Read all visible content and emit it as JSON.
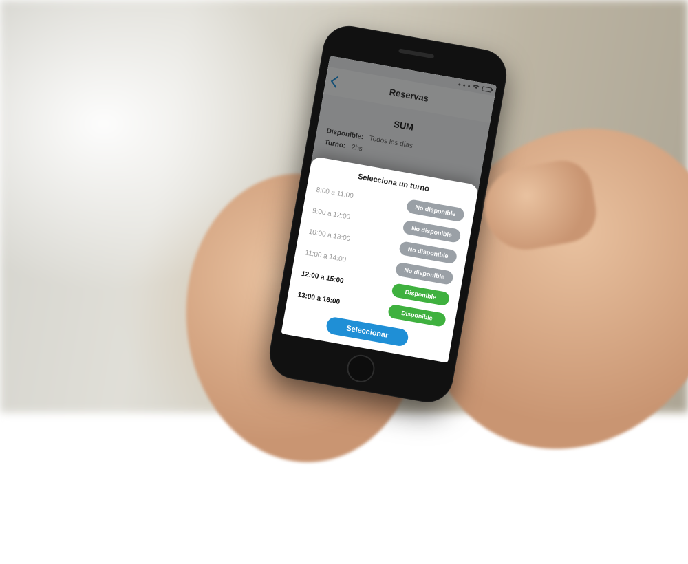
{
  "nav": {
    "title": "Reservas"
  },
  "section": {
    "title": "SUM"
  },
  "meta": {
    "availability_label": "Disponible:",
    "availability_value": "Todos los días",
    "turn_label": "Turno:",
    "turn_value": "2hs"
  },
  "sheet": {
    "title": "Selecciona un turno",
    "select_label": "Seleccionar",
    "status_labels": {
      "unavailable": "No disponible",
      "available": "Disponible"
    },
    "slots": [
      {
        "time": "8:00 a 11:00",
        "status": "unavailable"
      },
      {
        "time": "9:00 a 12:00",
        "status": "unavailable"
      },
      {
        "time": "10:00 a 13:00",
        "status": "unavailable"
      },
      {
        "time": "11:00 a 14:00",
        "status": "unavailable"
      },
      {
        "time": "12:00 a 15:00",
        "status": "available"
      },
      {
        "time": "13:00 a 16:00",
        "status": "available"
      }
    ]
  },
  "colors": {
    "accent": "#1f8fd6",
    "available": "#3fb13f",
    "unavailable": "#9aa0a6"
  }
}
